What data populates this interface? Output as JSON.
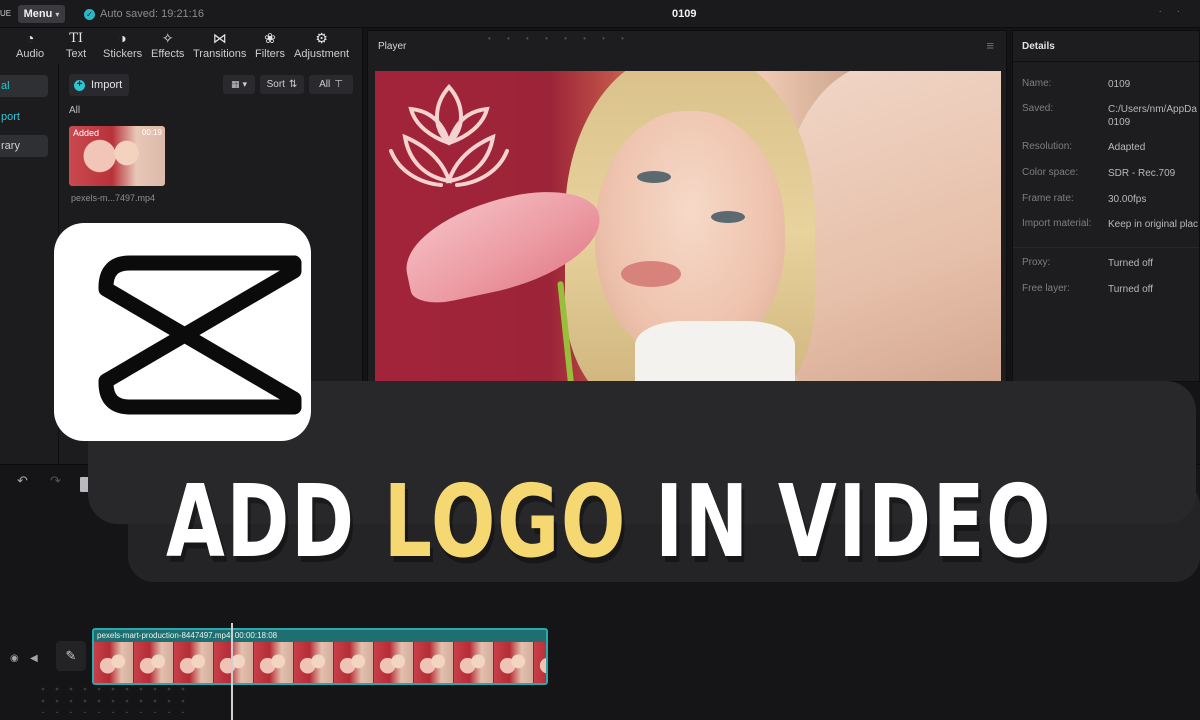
{
  "topbar": {
    "brand_fragment": "UE",
    "menu_label": "Menu",
    "autosave_text": "Auto saved: 19:21:16",
    "project_title": "0109"
  },
  "toolbar": {
    "items": [
      {
        "label": "Audio",
        "icon": "audio-icon"
      },
      {
        "label": "Text",
        "icon": "text-icon",
        "glyph": "TI"
      },
      {
        "label": "Stickers",
        "icon": "sticker-icon"
      },
      {
        "label": "Effects",
        "icon": "effects-icon"
      },
      {
        "label": "Transitions",
        "icon": "transitions-icon"
      },
      {
        "label": "Filters",
        "icon": "filters-icon"
      },
      {
        "label": "Adjustment",
        "icon": "adjustment-icon"
      }
    ]
  },
  "side_nav": {
    "items": [
      {
        "label": "al"
      },
      {
        "label": "port"
      },
      {
        "label": "rary"
      }
    ]
  },
  "media": {
    "import_label": "Import",
    "sort_label": "Sort",
    "filter_label": "All",
    "section_label": "All",
    "thumb_badge": "Added",
    "thumb_duration": "00:19",
    "file_name": "pexels-m...7497.mp4"
  },
  "player": {
    "title": "Player"
  },
  "details": {
    "title": "Details",
    "rows": [
      {
        "key": "Name:",
        "value": "0109"
      },
      {
        "key": "Saved:",
        "value": "C:/Users/nm/AppDa",
        "value2": "0109"
      },
      {
        "key": "Resolution:",
        "value": "Adapted"
      },
      {
        "key": "Color space:",
        "value": "SDR - Rec.709"
      },
      {
        "key": "Frame rate:",
        "value": "30.00fps"
      },
      {
        "key": "Import material:",
        "value": "Keep in original plac"
      },
      {
        "key": "Proxy:",
        "value": "Turned off"
      },
      {
        "key": "Free layer:",
        "value": "Turned off"
      }
    ]
  },
  "timeline": {
    "clip_name": "pexels-mart-production-8447497.mp4",
    "clip_duration": "00:00:18:08"
  },
  "overlay": {
    "headline_part1": "ADD ",
    "headline_highlight": "LOGO",
    "headline_part2": " IN VIDEO",
    "highlight_color": "#f6d872"
  }
}
